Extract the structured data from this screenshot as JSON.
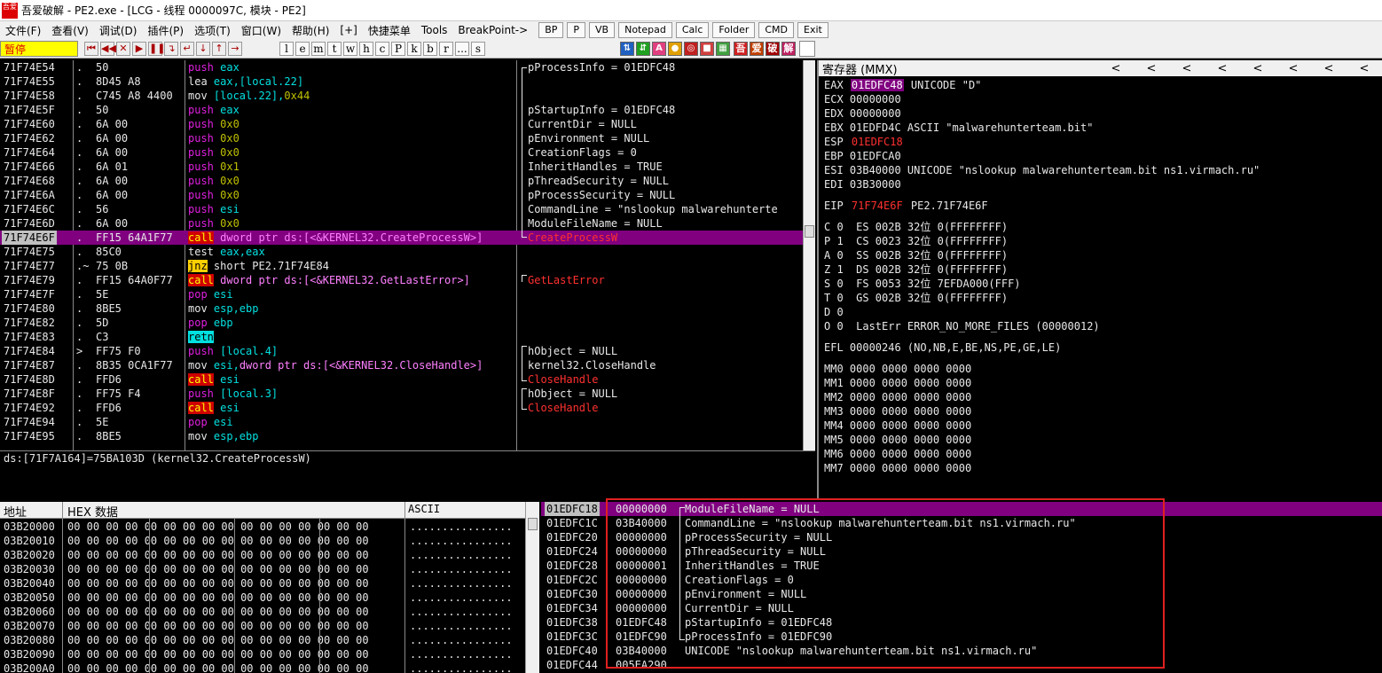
{
  "titlebar": {
    "app_icon": "吾爱",
    "text": "吾爱破解 - PE2.exe - [LCG - 线程 0000097C, 模块 - PE2]"
  },
  "menubar": {
    "items": [
      "文件(F)",
      "查看(V)",
      "调试(D)",
      "插件(P)",
      "选项(T)",
      "窗口(W)",
      "帮助(H)",
      "[+]",
      "快捷菜单",
      "Tools",
      "BreakPoint->"
    ],
    "buttons": [
      "BP",
      "P",
      "VB",
      "Notepad",
      "Calc",
      "Folder",
      "CMD",
      "Exit"
    ]
  },
  "toolbar": {
    "status": "暂停",
    "tools": [
      "⏮",
      "◀◀",
      "✕",
      "▶",
      "❚❚",
      "↴",
      "↵",
      "↓",
      "↑",
      "→"
    ],
    "letters": [
      "l",
      "e",
      "m",
      "t",
      "w",
      "h",
      "c",
      "P",
      "k",
      "b",
      "r",
      "...",
      "s"
    ],
    "right_icons": [
      "吾",
      "爱",
      "破",
      "解"
    ]
  },
  "cpu": {
    "rows": [
      {
        "addr": "71F74E54",
        "mark": ".",
        "hex": "50",
        "dis": [
          {
            "t": "push",
            "c": "#e020e0"
          },
          {
            "t": " eax",
            "c": "#00e0e0"
          }
        ],
        "cmt": [
          {
            "t": "pProcessInfo = 01EDFC48",
            "c": "#e8e8e8"
          }
        ]
      },
      {
        "addr": "71F74E55",
        "mark": ".",
        "hex": "8D45 A8",
        "dis": [
          {
            "t": "lea ",
            "c": "#e8e8e8"
          },
          {
            "t": "eax,[local.22]",
            "c": "#00e0e0"
          }
        ],
        "cmt": []
      },
      {
        "addr": "71F74E58",
        "mark": ".",
        "hex": "C745 A8 4400",
        "dis": [
          {
            "t": "mov ",
            "c": "#e8e8e8"
          },
          {
            "t": "[local.22],",
            "c": "#00e0e0"
          },
          {
            "t": "0x44",
            "c": "#c0c000"
          }
        ],
        "cmt": []
      },
      {
        "addr": "71F74E5F",
        "mark": ".",
        "hex": "50",
        "dis": [
          {
            "t": "push",
            "c": "#e020e0"
          },
          {
            "t": " eax",
            "c": "#00e0e0"
          }
        ],
        "cmt": [
          {
            "t": "pStartupInfo = 01EDFC48",
            "c": "#e8e8e8"
          }
        ]
      },
      {
        "addr": "71F74E60",
        "mark": ".",
        "hex": "6A 00",
        "dis": [
          {
            "t": "push",
            "c": "#e020e0"
          },
          {
            "t": " 0x0",
            "c": "#c0c000"
          }
        ],
        "cmt": [
          {
            "t": "CurrentDir = NULL",
            "c": "#e8e8e8"
          }
        ]
      },
      {
        "addr": "71F74E62",
        "mark": ".",
        "hex": "6A 00",
        "dis": [
          {
            "t": "push",
            "c": "#e020e0"
          },
          {
            "t": " 0x0",
            "c": "#c0c000"
          }
        ],
        "cmt": [
          {
            "t": "pEnvironment = NULL",
            "c": "#e8e8e8"
          }
        ]
      },
      {
        "addr": "71F74E64",
        "mark": ".",
        "hex": "6A 00",
        "dis": [
          {
            "t": "push",
            "c": "#e020e0"
          },
          {
            "t": " 0x0",
            "c": "#c0c000"
          }
        ],
        "cmt": [
          {
            "t": "CreationFlags = 0",
            "c": "#e8e8e8"
          }
        ]
      },
      {
        "addr": "71F74E66",
        "mark": ".",
        "hex": "6A 01",
        "dis": [
          {
            "t": "push",
            "c": "#e020e0"
          },
          {
            "t": " 0x1",
            "c": "#c0c000"
          }
        ],
        "cmt": [
          {
            "t": "InheritHandles = TRUE",
            "c": "#e8e8e8"
          }
        ]
      },
      {
        "addr": "71F74E68",
        "mark": ".",
        "hex": "6A 00",
        "dis": [
          {
            "t": "push",
            "c": "#e020e0"
          },
          {
            "t": " 0x0",
            "c": "#c0c000"
          }
        ],
        "cmt": [
          {
            "t": "pThreadSecurity = NULL",
            "c": "#e8e8e8"
          }
        ]
      },
      {
        "addr": "71F74E6A",
        "mark": ".",
        "hex": "6A 00",
        "dis": [
          {
            "t": "push",
            "c": "#e020e0"
          },
          {
            "t": " 0x0",
            "c": "#c0c000"
          }
        ],
        "cmt": [
          {
            "t": "pProcessSecurity = NULL",
            "c": "#e8e8e8"
          }
        ]
      },
      {
        "addr": "71F74E6C",
        "mark": ".",
        "hex": "56",
        "dis": [
          {
            "t": "push",
            "c": "#e020e0"
          },
          {
            "t": " esi",
            "c": "#00e0e0"
          }
        ],
        "cmt": [
          {
            "t": "CommandLine = \"nslookup malwarehunterte",
            "c": "#e8e8e8"
          }
        ]
      },
      {
        "addr": "71F74E6D",
        "mark": ".",
        "hex": "6A 00",
        "dis": [
          {
            "t": "push",
            "c": "#e020e0"
          },
          {
            "t": " 0x0",
            "c": "#c0c000"
          }
        ],
        "cmt": [
          {
            "t": "ModuleFileName = NULL",
            "c": "#e8e8e8"
          }
        ]
      },
      {
        "addr": "71F74E6F",
        "mark": ".",
        "hex": "FF15 64A1F77",
        "sel": true,
        "dis": [
          {
            "t": "call",
            "c": "#ffff00",
            "bg": "#d00000"
          },
          {
            "t": " dword ptr ds:[<&KERNEL32.CreateProcessW>]",
            "c": "#ff80ff"
          }
        ],
        "cmt": [
          {
            "t": "CreateProcessW",
            "c": "#ff3030"
          }
        ]
      },
      {
        "addr": "71F74E75",
        "mark": ".",
        "hex": "85C0",
        "dis": [
          {
            "t": "test ",
            "c": "#e8e8e8"
          },
          {
            "t": "eax,eax",
            "c": "#00e0e0"
          }
        ],
        "cmt": []
      },
      {
        "addr": "71F74E77",
        "mark": ".~",
        "hex": "75 0B",
        "dis": [
          {
            "t": "jnz",
            "c": "#000000",
            "bg": "#ffd000"
          },
          {
            "t": " short PE2.71F74E84",
            "c": "#e8e8e8"
          }
        ],
        "cmt": []
      },
      {
        "addr": "71F74E79",
        "mark": ".",
        "hex": "FF15 64A0F77",
        "dis": [
          {
            "t": "call",
            "c": "#ffff00",
            "bg": "#d00000"
          },
          {
            "t": " dword ptr ds:[<&KERNEL32.GetLastError>]",
            "c": "#ff80ff"
          }
        ],
        "cmt": [
          {
            "t": "GetLastError",
            "c": "#ff3030"
          }
        ]
      },
      {
        "addr": "71F74E7F",
        "mark": ".",
        "hex": "5E",
        "dis": [
          {
            "t": "pop",
            "c": "#e020e0"
          },
          {
            "t": " esi",
            "c": "#00e0e0"
          }
        ],
        "cmt": []
      },
      {
        "addr": "71F74E80",
        "mark": ".",
        "hex": "8BE5",
        "dis": [
          {
            "t": "mov ",
            "c": "#e8e8e8"
          },
          {
            "t": "esp,ebp",
            "c": "#00e0e0"
          }
        ],
        "cmt": []
      },
      {
        "addr": "71F74E82",
        "mark": ".",
        "hex": "5D",
        "dis": [
          {
            "t": "pop",
            "c": "#e020e0"
          },
          {
            "t": " ebp",
            "c": "#00e0e0"
          }
        ],
        "cmt": []
      },
      {
        "addr": "71F74E83",
        "mark": ".",
        "hex": "C3",
        "dis": [
          {
            "t": "retn",
            "c": "#000000",
            "bg": "#00e0e0"
          }
        ],
        "cmt": []
      },
      {
        "addr": "71F74E84",
        "mark": ">",
        "hex": "FF75 F0",
        "dis": [
          {
            "t": "push",
            "c": "#e020e0"
          },
          {
            "t": " [local.4]",
            "c": "#00e0e0"
          }
        ],
        "cmt": [
          {
            "t": "hObject = NULL",
            "c": "#e8e8e8"
          }
        ]
      },
      {
        "addr": "71F74E87",
        "mark": ".",
        "hex": "8B35 0CA1F77",
        "dis": [
          {
            "t": "mov ",
            "c": "#e8e8e8"
          },
          {
            "t": "esi,",
            "c": "#00e0e0"
          },
          {
            "t": "dword ptr ds:[<&KERNEL32.CloseHandle>]",
            "c": "#ff80ff"
          }
        ],
        "cmt": [
          {
            "t": "kernel32.CloseHandle",
            "c": "#e8e8e8"
          }
        ]
      },
      {
        "addr": "71F74E8D",
        "mark": ".",
        "hex": "FFD6",
        "dis": [
          {
            "t": "call",
            "c": "#ffff00",
            "bg": "#d00000"
          },
          {
            "t": " esi",
            "c": "#00e0e0"
          }
        ],
        "cmt": [
          {
            "t": "CloseHandle",
            "c": "#ff3030"
          }
        ]
      },
      {
        "addr": "71F74E8F",
        "mark": ".",
        "hex": "FF75 F4",
        "dis": [
          {
            "t": "push",
            "c": "#e020e0"
          },
          {
            "t": " [local.3]",
            "c": "#00e0e0"
          }
        ],
        "cmt": [
          {
            "t": "hObject = NULL",
            "c": "#e8e8e8"
          }
        ]
      },
      {
        "addr": "71F74E92",
        "mark": ".",
        "hex": "FFD6",
        "dis": [
          {
            "t": "call",
            "c": "#ffff00",
            "bg": "#d00000"
          },
          {
            "t": " esi",
            "c": "#00e0e0"
          }
        ],
        "cmt": [
          {
            "t": "CloseHandle",
            "c": "#ff3030"
          }
        ]
      },
      {
        "addr": "71F74E94",
        "mark": ".",
        "hex": "5E",
        "dis": [
          {
            "t": "pop",
            "c": "#e020e0"
          },
          {
            "t": " esi",
            "c": "#00e0e0"
          }
        ],
        "cmt": []
      },
      {
        "addr": "71F74E95",
        "mark": ".",
        "hex": "8BE5",
        "dis": [
          {
            "t": "mov ",
            "c": "#e8e8e8"
          },
          {
            "t": "esp,ebp",
            "c": "#00e0e0"
          }
        ],
        "cmt": []
      }
    ]
  },
  "info_text": "ds:[71F7A164]=75BA103D (kernel32.CreateProcessW)",
  "registers": {
    "title": "寄存器 (MMX)",
    "arrows": [
      "<",
      "<",
      "<",
      "<",
      "<",
      "<",
      "<",
      "<"
    ],
    "rows": [
      {
        "y": 0,
        "parts": [
          {
            "t": "EAX "
          },
          {
            "t": "01EDFC48",
            "bg": "#800080",
            "c": "#ffffff"
          },
          {
            "t": " UNICODE \"D\""
          }
        ]
      },
      {
        "y": 1,
        "parts": [
          {
            "t": "ECX 00000000"
          }
        ]
      },
      {
        "y": 2,
        "parts": [
          {
            "t": "EDX 00000000"
          }
        ]
      },
      {
        "y": 3,
        "parts": [
          {
            "t": "EBX 01EDFD4C ASCII \"malwarehunterteam.bit\""
          }
        ]
      },
      {
        "y": 4,
        "parts": [
          {
            "t": "ESP "
          },
          {
            "t": "01EDFC18",
            "c": "#ff3030"
          }
        ]
      },
      {
        "y": 5,
        "parts": [
          {
            "t": "EBP 01EDFCA0"
          }
        ]
      },
      {
        "y": 6,
        "parts": [
          {
            "t": "ESI 03B40000 UNICODE \"nslookup malwarehunterteam.bit ns1.virmach.ru\""
          }
        ]
      },
      {
        "y": 7,
        "parts": [
          {
            "t": "EDI 03B30000"
          }
        ]
      },
      {
        "y": 8.5,
        "parts": [
          {
            "t": "EIP "
          },
          {
            "t": "71F74E6F",
            "c": "#ff3030"
          },
          {
            "t": " PE2.71F74E6F"
          }
        ]
      },
      {
        "y": 10,
        "parts": [
          {
            "t": "C 0  ES 002B 32位 0(FFFFFFFF)"
          }
        ]
      },
      {
        "y": 11,
        "parts": [
          {
            "t": "P 1  CS 0023 32位 0(FFFFFFFF)"
          }
        ]
      },
      {
        "y": 12,
        "parts": [
          {
            "t": "A 0  SS 002B 32位 0(FFFFFFFF)"
          }
        ]
      },
      {
        "y": 13,
        "parts": [
          {
            "t": "Z 1  DS 002B 32位 0(FFFFFFFF)"
          }
        ]
      },
      {
        "y": 14,
        "parts": [
          {
            "t": "S 0  FS 0053 32位 7EFDA000(FFF)"
          }
        ]
      },
      {
        "y": 15,
        "parts": [
          {
            "t": "T 0  GS 002B 32位 0(FFFFFFFF)"
          }
        ]
      },
      {
        "y": 16,
        "parts": [
          {
            "t": "D 0"
          }
        ]
      },
      {
        "y": 17,
        "parts": [
          {
            "t": "O 0  LastErr ERROR_NO_MORE_FILES (00000012)"
          }
        ]
      },
      {
        "y": 18.5,
        "parts": [
          {
            "t": "EFL 00000246 (NO,NB,E,BE,NS,PE,GE,LE)"
          }
        ]
      },
      {
        "y": 20,
        "parts": [
          {
            "t": "MM0 0000 0000 0000 0000"
          }
        ]
      },
      {
        "y": 21,
        "parts": [
          {
            "t": "MM1 0000 0000 0000 0000"
          }
        ]
      },
      {
        "y": 22,
        "parts": [
          {
            "t": "MM2 0000 0000 0000 0000"
          }
        ]
      },
      {
        "y": 23,
        "parts": [
          {
            "t": "MM3 0000 0000 0000 0000"
          }
        ]
      },
      {
        "y": 24,
        "parts": [
          {
            "t": "MM4 0000 0000 0000 0000"
          }
        ]
      },
      {
        "y": 25,
        "parts": [
          {
            "t": "MM5 0000 0000 0000 0000"
          }
        ]
      },
      {
        "y": 26,
        "parts": [
          {
            "t": "MM6 0000 0000 0000 0000"
          }
        ]
      },
      {
        "y": 27,
        "parts": [
          {
            "t": "MM7 0000 0000 0000 0000"
          }
        ]
      }
    ]
  },
  "dump": {
    "col_addr": "地址",
    "col_hex": "HEX 数据",
    "col_ascii": "ASCII",
    "rows": [
      {
        "addr": "03B20000",
        "hex": "00 00 00 00 00 00 00 00 00 00 00 00 00 00 00 00",
        "ascii": "................"
      },
      {
        "addr": "03B20010",
        "hex": "00 00 00 00 00 00 00 00 00 00 00 00 00 00 00 00",
        "ascii": "................"
      },
      {
        "addr": "03B20020",
        "hex": "00 00 00 00 00 00 00 00 00 00 00 00 00 00 00 00",
        "ascii": "................"
      },
      {
        "addr": "03B20030",
        "hex": "00 00 00 00 00 00 00 00 00 00 00 00 00 00 00 00",
        "ascii": "................"
      },
      {
        "addr": "03B20040",
        "hex": "00 00 00 00 00 00 00 00 00 00 00 00 00 00 00 00",
        "ascii": "................"
      },
      {
        "addr": "03B20050",
        "hex": "00 00 00 00 00 00 00 00 00 00 00 00 00 00 00 00",
        "ascii": "................"
      },
      {
        "addr": "03B20060",
        "hex": "00 00 00 00 00 00 00 00 00 00 00 00 00 00 00 00",
        "ascii": "................"
      },
      {
        "addr": "03B20070",
        "hex": "00 00 00 00 00 00 00 00 00 00 00 00 00 00 00 00",
        "ascii": "................"
      },
      {
        "addr": "03B20080",
        "hex": "00 00 00 00 00 00 00 00 00 00 00 00 00 00 00 00",
        "ascii": "................"
      },
      {
        "addr": "03B20090",
        "hex": "00 00 00 00 00 00 00 00 00 00 00 00 00 00 00 00",
        "ascii": "................"
      },
      {
        "addr": "03B200A0",
        "hex": "00 00 00 00 00 00 00 00 00 00 00 00 00 00 00 00",
        "ascii": "................"
      }
    ]
  },
  "stack": {
    "rows": [
      {
        "addr": "01EDFC18",
        "val": "00000000",
        "cmt": "ModuleFileName = NULL",
        "sel": true
      },
      {
        "addr": "01EDFC1C",
        "val": "03B40000",
        "cmt": "CommandLine = \"nslookup malwarehunterteam.bit ns1.virmach.ru\""
      },
      {
        "addr": "01EDFC20",
        "val": "00000000",
        "cmt": "pProcessSecurity = NULL"
      },
      {
        "addr": "01EDFC24",
        "val": "00000000",
        "cmt": "pThreadSecurity = NULL"
      },
      {
        "addr": "01EDFC28",
        "val": "00000001",
        "cmt": "InheritHandles = TRUE"
      },
      {
        "addr": "01EDFC2C",
        "val": "00000000",
        "cmt": "CreationFlags = 0"
      },
      {
        "addr": "01EDFC30",
        "val": "00000000",
        "cmt": "pEnvironment = NULL"
      },
      {
        "addr": "01EDFC34",
        "val": "00000000",
        "cmt": "CurrentDir = NULL"
      },
      {
        "addr": "01EDFC38",
        "val": "01EDFC48",
        "cmt": "pStartupInfo = 01EDFC48"
      },
      {
        "addr": "01EDFC3C",
        "val": "01EDFC90",
        "cmt": "pProcessInfo = 01EDFC90"
      },
      {
        "addr": "01EDFC40",
        "val": "03B40000",
        "cmt": "UNICODE \"nslookup malwarehunterteam.bit ns1.virmach.ru\""
      },
      {
        "addr": "01EDFC44",
        "val": "005EA290",
        "cmt": ""
      }
    ]
  }
}
